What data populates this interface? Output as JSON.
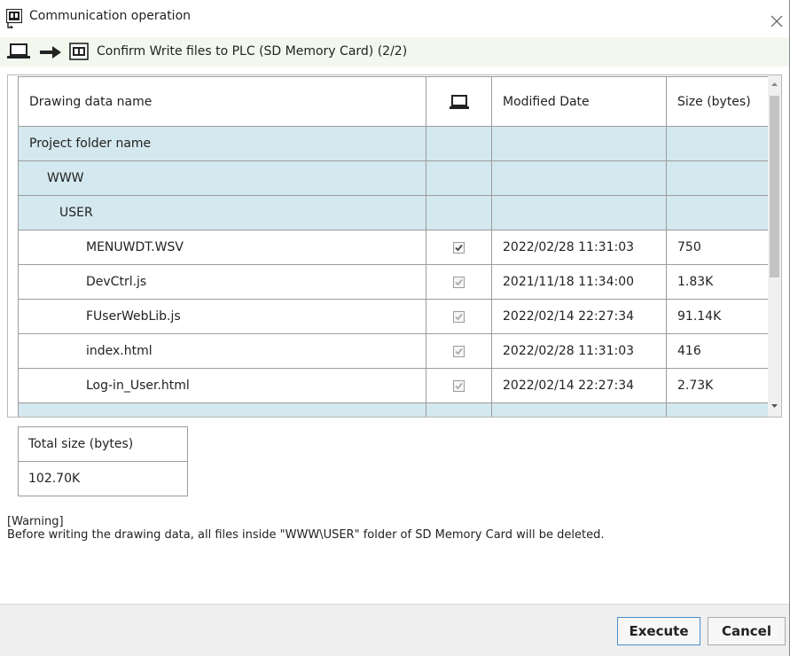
{
  "window": {
    "title": "Communication operation",
    "step_text": "Confirm Write files to PLC (SD Memory Card) (2/2)"
  },
  "table": {
    "columns": [
      "Drawing data name",
      "laptop-icon",
      "Modified Date",
      "Size (bytes)"
    ],
    "rows": [
      {
        "name": "Project folder name",
        "type": "folder",
        "checked": null,
        "date": "",
        "size": ""
      },
      {
        "name": "WWW",
        "type": "folder",
        "checked": null,
        "date": "",
        "size": ""
      },
      {
        "name": "USER",
        "type": "folder",
        "checked": null,
        "date": "",
        "size": ""
      },
      {
        "name": "MENUWDT.WSV",
        "type": "file",
        "checked": true,
        "date": "2022/02/28 11:31:03",
        "size": "750"
      },
      {
        "name": "DevCtrl.js",
        "type": "file",
        "checked": true,
        "date": "2021/11/18 11:34:00",
        "size": "1.83K"
      },
      {
        "name": "FUserWebLib.js",
        "type": "file",
        "checked": true,
        "date": "2022/02/14 22:27:34",
        "size": "91.14K"
      },
      {
        "name": "index.html",
        "type": "file",
        "checked": true,
        "date": "2022/02/28 11:31:03",
        "size": "416"
      },
      {
        "name": "Log-in_User.html",
        "type": "file",
        "checked": true,
        "date": "2022/02/14 22:27:34",
        "size": "2.73K"
      }
    ]
  },
  "total": {
    "label": "Total size (bytes)",
    "value": "102.70K"
  },
  "warning": {
    "title": "[Warning]",
    "message": "Before writing the drawing data, all files inside \"WWW\\USER\" folder of SD Memory Card will be deleted."
  },
  "buttons": {
    "execute": "Execute",
    "cancel": "Cancel"
  },
  "icons": {
    "title": "sd-card-transfer-icon",
    "close": "close-icon",
    "source": "laptop-icon",
    "arrow": "arrow-right-icon",
    "target": "sd-card-icon"
  },
  "colors": {
    "folder_row": "#d4e8ef",
    "subheader": "#f3f8ee",
    "execute_border": "#4a8ccc"
  }
}
